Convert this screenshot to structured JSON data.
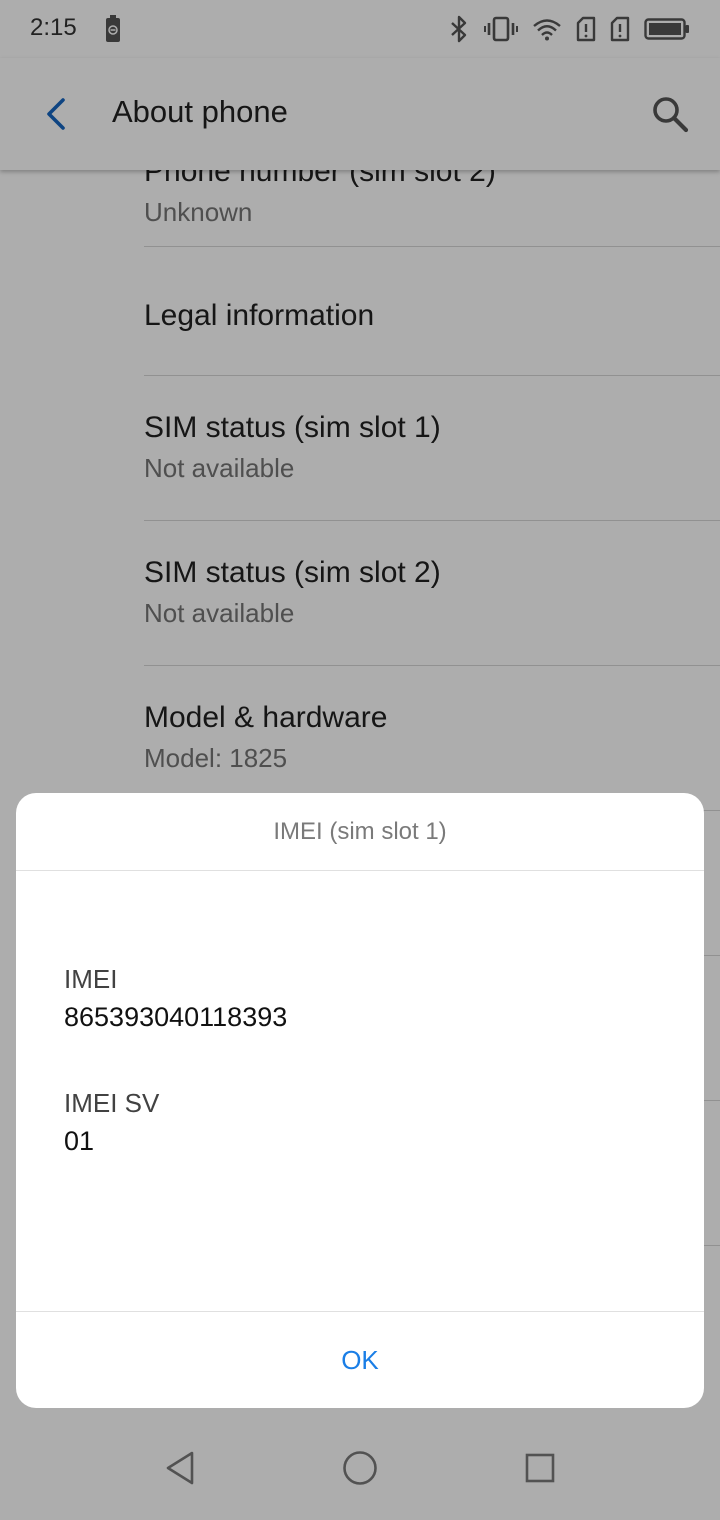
{
  "status_bar": {
    "time": "2:15",
    "icons": [
      "battery-saver-icon",
      "bluetooth-icon",
      "vibrate-icon",
      "wifi-icon",
      "sim-slot-1-icon",
      "sim-slot-2-icon",
      "battery-icon"
    ]
  },
  "app_bar": {
    "title": "About phone",
    "back_icon": "back-arrow-icon",
    "search_icon": "search-icon"
  },
  "list": {
    "items": [
      {
        "title": "Phone number (sim slot 2)",
        "subtitle": "Unknown"
      },
      {
        "title": "Legal information",
        "subtitle": ""
      },
      {
        "title": "SIM status (sim slot 1)",
        "subtitle": "Not available"
      },
      {
        "title": "SIM status (sim slot 2)",
        "subtitle": "Not available"
      },
      {
        "title": "Model & hardware",
        "subtitle": "Model: 1825"
      }
    ]
  },
  "dialog": {
    "title": "IMEI (sim slot 1)",
    "fields": [
      {
        "label": "IMEI",
        "value": "865393040118393"
      },
      {
        "label": "IMEI SV",
        "value": "01"
      }
    ],
    "ok_label": "OK"
  },
  "nav_bar": {
    "icons": [
      "back-triangle-icon",
      "home-circle-icon",
      "recents-square-icon"
    ]
  },
  "colors": {
    "accent": "#1a7ee6",
    "back_arrow": "#1565c0",
    "scrim": "rgba(0,0,0,0.32)"
  }
}
